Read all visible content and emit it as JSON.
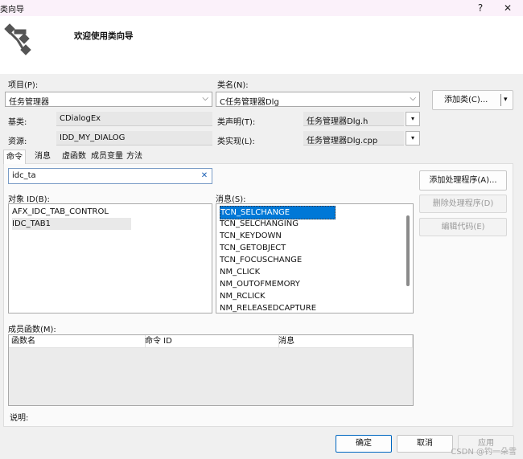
{
  "window": {
    "title": "类向导",
    "help_label": "?",
    "close_label": "✕"
  },
  "header": {
    "welcome": "欢迎使用类向导",
    "logo_icon": "class-wizard-logo-icon"
  },
  "project": {
    "label": "项目(P):",
    "value": "任务管理器"
  },
  "classname": {
    "label": "类名(N):",
    "value": "C任务管理器Dlg"
  },
  "add_class_button": {
    "label": "添加类(C)...",
    "arrow": "▾"
  },
  "base_class": {
    "label": "基类:",
    "value": "CDialogEx"
  },
  "resource": {
    "label": "资源:",
    "value": "IDD_MY_DIALOG"
  },
  "class_decl": {
    "label": "类声明(T):",
    "value": "任务管理器Dlg.h",
    "arrow": "▾"
  },
  "class_impl": {
    "label": "类实现(L):",
    "value": "任务管理器Dlg.cpp",
    "arrow": "▾"
  },
  "tabs": [
    {
      "label": "命令",
      "active": true
    },
    {
      "label": "消息",
      "active": false
    },
    {
      "label": "虚函数",
      "active": false
    },
    {
      "label": "成员变量",
      "active": false
    },
    {
      "label": "方法",
      "active": false
    }
  ],
  "search": {
    "value": "idc_ta",
    "clear_icon": "clear-icon"
  },
  "object_ids": {
    "label": "对象 ID(B):",
    "items": [
      "AFX_IDC_TAB_CONTROL",
      "IDC_TAB1"
    ]
  },
  "messages": {
    "label": "消息(S):",
    "items": [
      "TCN_SELCHANGE",
      "TCN_SELCHANGING",
      "TCN_KEYDOWN",
      "TCN_GETOBJECT",
      "TCN_FOCUSCHANGE",
      "NM_CLICK",
      "NM_OUTOFMEMORY",
      "NM_RCLICK",
      "NM_RELEASEDCAPTURE"
    ]
  },
  "actions": {
    "add_handler": "添加处理程序(A)...",
    "delete_handler": "删除处理程序(D)",
    "edit_code": "编辑代码(E)"
  },
  "members": {
    "label": "成员函数(M):",
    "columns": [
      "函数名",
      "命令 ID",
      "消息"
    ]
  },
  "description": {
    "label": "说明:"
  },
  "footer": {
    "ok": "确定",
    "cancel": "取消",
    "apply": "应用"
  },
  "watermark": "CSDN @钓一朵雪",
  "colors": {
    "accent": "#0078d7",
    "titlebar_bg": "#fbf1fa"
  }
}
